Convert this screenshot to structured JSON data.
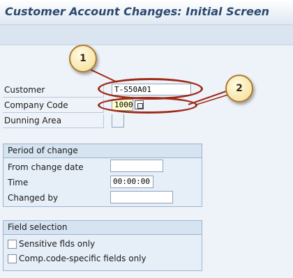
{
  "title": "Customer Account Changes: Initial Screen",
  "fields": {
    "customer": {
      "label": "Customer",
      "value": "T-S50A01"
    },
    "company_code": {
      "label": "Company Code",
      "value": "1000"
    },
    "dunning_area": {
      "label": "Dunning Area",
      "value": ""
    }
  },
  "period_group": {
    "title": "Period of change",
    "from_change_date": {
      "label": "From change date",
      "value": ""
    },
    "time": {
      "label": "Time",
      "value": "00:00:00"
    },
    "changed_by": {
      "label": "Changed by",
      "value": ""
    }
  },
  "selection_group": {
    "title": "Field selection",
    "sensitive": {
      "label": "Sensitive flds only",
      "checked": false
    },
    "company_specific": {
      "label": "Comp.code-specific fields only",
      "checked": false
    }
  },
  "callouts": [
    "1",
    "2"
  ],
  "colors": {
    "callout_ring": "#9e2a18",
    "badge_fill": "#f7e6a8",
    "title_text": "#2c4a6e",
    "highlight_field": "#ffffcc"
  }
}
